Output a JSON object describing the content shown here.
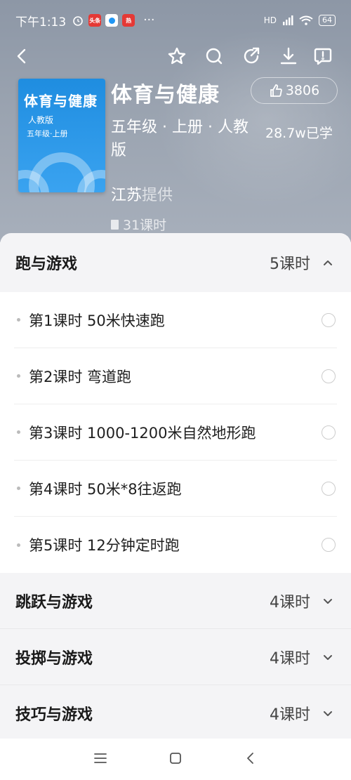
{
  "status_bar": {
    "time": "下午1:13",
    "app_icons": [
      {
        "name": "alarm-icon",
        "color": "#ffffff"
      },
      {
        "name": "toutiao-icon",
        "color": "#e53935",
        "label": "头条"
      },
      {
        "name": "app-icon",
        "color": "#2196f3"
      },
      {
        "name": "news-icon",
        "color": "#e53935"
      }
    ],
    "more": "···",
    "network": "HD",
    "battery": "64"
  },
  "toolbar": {
    "icons": [
      "back-icon",
      "star-icon",
      "search-icon",
      "share-icon",
      "download-icon",
      "report-icon"
    ]
  },
  "book": {
    "cover_title": "体育与健康",
    "cover_publisher": "人教版",
    "cover_grade": "五年级·上册",
    "title": "体育与健康",
    "meta": "五年级 · 上册 · 人教版",
    "likes": "3806",
    "learners": "28.7w已学",
    "provider": "江苏",
    "provider_suffix": "提供",
    "lesson_total": "31课时"
  },
  "sections": [
    {
      "title": "跑与游戏",
      "count": "5课时",
      "expanded": true,
      "lessons": [
        "第1课时 50米快速跑",
        "第2课时 弯道跑",
        "第3课时 1000-1200米自然地形跑",
        "第4课时 50米*8往返跑",
        "第5课时 12分钟定时跑"
      ]
    },
    {
      "title": "跳跃与游戏",
      "count": "4课时",
      "expanded": false
    },
    {
      "title": "投掷与游戏",
      "count": "4课时",
      "expanded": false
    },
    {
      "title": "技巧与游戏",
      "count": "4课时",
      "expanded": false
    }
  ],
  "colors": {
    "hero_bg": "#9aa3b0",
    "cover_blue": "#2a96e8",
    "sheet_bg": "#f4f4f6"
  }
}
